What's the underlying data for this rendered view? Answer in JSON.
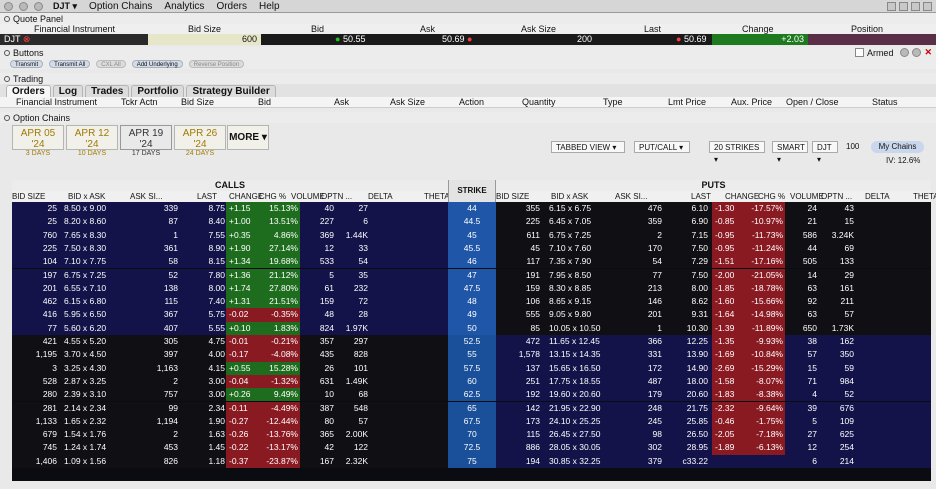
{
  "app": {
    "symbol": "DJT",
    "menus": [
      "Option Chains",
      "Analytics",
      "Orders",
      "Help"
    ]
  },
  "quote": {
    "section": "Quote Panel",
    "headers": [
      "Financial Instrument",
      "Bid Size",
      "Bid",
      "Ask",
      "Ask Size",
      "Last",
      "Change",
      "Position"
    ],
    "symbol": "DJT",
    "bid_size": "600",
    "bid": "50.55",
    "ask": "50.69",
    "ask_size": "200",
    "last": "50.69",
    "change": "+2.03",
    "position": ""
  },
  "buttons": {
    "section": "Buttons",
    "items": [
      "Transmit",
      "Transmit All",
      "CXL All",
      "Add Underlying",
      "Reverse Position"
    ],
    "armed": "Armed"
  },
  "trading": {
    "section": "Trading",
    "tabs": [
      "Orders",
      "Log",
      "Trades",
      "Portfolio",
      "Strategy Builder"
    ],
    "columns": [
      "Financial Instrument",
      "Tckr Actn",
      "Bid Size",
      "Bid",
      "Ask",
      "Ask Size",
      "Action",
      "Quantity",
      "Type",
      "Lmt Price",
      "Aux. Price",
      "Open / Close",
      "Status"
    ]
  },
  "chains": {
    "section": "Option Chains",
    "expiries": [
      {
        "label": "APR 05 '24",
        "days": "3 DAYS"
      },
      {
        "label": "APR 12 '24",
        "days": "10 DAYS"
      },
      {
        "label": "APR 19 '24",
        "days": "17 DAYS"
      },
      {
        "label": "APR 26 '24",
        "days": "24 DAYS"
      }
    ],
    "more": "MORE",
    "view": "TABBED VIEW",
    "type": "PUT/CALL",
    "strikes": "20 STRIKES",
    "exchange": "SMART",
    "under": "DJT",
    "mult": "100",
    "mychains": "My Chains",
    "iv": "IV: 12.6%",
    "calls_label": "CALLS",
    "puts_label": "PUTS",
    "strike_label": "STRIKE",
    "call_cols": [
      "BID SIZE",
      "BID x ASK",
      "ASK SI...",
      "LAST",
      "CHANGE",
      "CHG %",
      "VOLUME",
      "OPTN ...",
      "DELTA",
      "THETA"
    ],
    "put_cols": [
      "BID SIZE",
      "BID x ASK",
      "ASK SI...",
      "LAST",
      "CHANGE",
      "CHG %",
      "VOLUME",
      "OPTN ...",
      "DELTA",
      "THETA"
    ]
  },
  "rows": [
    {
      "strike": "44",
      "c": [
        "25",
        "8.50 x 9.00",
        "339",
        "8.75",
        "+1.15",
        "15.13%",
        "40",
        "27"
      ],
      "p": [
        "355",
        "6.15 x 6.75",
        "476",
        "6.10",
        "-1.30",
        "-17.57%",
        "24",
        "43"
      ]
    },
    {
      "strike": "44.5",
      "c": [
        "25",
        "8.20 x 8.60",
        "87",
        "8.40",
        "+1.00",
        "13.51%",
        "227",
        "6"
      ],
      "p": [
        "225",
        "6.45 x 7.05",
        "359",
        "6.90",
        "-0.85",
        "-10.97%",
        "21",
        "15"
      ]
    },
    {
      "strike": "45",
      "c": [
        "760",
        "7.65 x 8.30",
        "1",
        "7.55",
        "+0.35",
        "4.86%",
        "369",
        "1.44K"
      ],
      "p": [
        "611",
        "6.75 x 7.25",
        "2",
        "7.15",
        "-0.95",
        "-11.73%",
        "586",
        "3.24K"
      ]
    },
    {
      "strike": "45.5",
      "c": [
        "225",
        "7.50 x 8.30",
        "361",
        "8.90",
        "+1.90",
        "27.14%",
        "12",
        "33"
      ],
      "p": [
        "45",
        "7.10 x 7.60",
        "170",
        "7.50",
        "-0.95",
        "-11.24%",
        "44",
        "69"
      ]
    },
    {
      "strike": "46",
      "c": [
        "104",
        "7.10 x 7.75",
        "58",
        "8.15",
        "+1.34",
        "19.68%",
        "533",
        "54"
      ],
      "p": [
        "117",
        "7.35 x 7.90",
        "54",
        "7.29",
        "-1.51",
        "-17.16%",
        "505",
        "133"
      ]
    },
    {
      "strike": "47",
      "c": [
        "197",
        "6.75 x 7.25",
        "52",
        "7.80",
        "+1.36",
        "21.12%",
        "5",
        "35"
      ],
      "p": [
        "191",
        "7.95 x 8.50",
        "77",
        "7.50",
        "-2.00",
        "-21.05%",
        "14",
        "29"
      ]
    },
    {
      "strike": "47.5",
      "c": [
        "201",
        "6.55 x 7.10",
        "138",
        "8.00",
        "+1.74",
        "27.80%",
        "61",
        "232"
      ],
      "p": [
        "159",
        "8.30 x 8.85",
        "213",
        "8.00",
        "-1.85",
        "-18.78%",
        "63",
        "161"
      ]
    },
    {
      "strike": "48",
      "c": [
        "462",
        "6.15 x 6.80",
        "115",
        "7.40",
        "+1.31",
        "21.51%",
        "159",
        "72"
      ],
      "p": [
        "106",
        "8.65 x 9.15",
        "146",
        "8.62",
        "-1.60",
        "-15.66%",
        "92",
        "211"
      ]
    },
    {
      "strike": "49",
      "c": [
        "416",
        "5.95 x 6.50",
        "367",
        "5.75",
        "-0.02",
        "-0.35%",
        "48",
        "28"
      ],
      "p": [
        "555",
        "9.05 x 9.80",
        "201",
        "9.31",
        "-1.64",
        "-14.98%",
        "63",
        "57"
      ]
    },
    {
      "strike": "50",
      "c": [
        "77",
        "5.60 x 6.20",
        "407",
        "5.55",
        "+0.10",
        "1.83%",
        "824",
        "1.97K"
      ],
      "p": [
        "85",
        "10.05 x 10.50",
        "1",
        "10.30",
        "-1.39",
        "-11.89%",
        "650",
        "1.73K"
      ]
    },
    {
      "strike": "52.5",
      "c": [
        "421",
        "4.55 x 5.20",
        "305",
        "4.75",
        "-0.01",
        "-0.21%",
        "357",
        "297"
      ],
      "p": [
        "472",
        "11.65 x 12.45",
        "366",
        "12.25",
        "-1.35",
        "-9.93%",
        "38",
        "162"
      ]
    },
    {
      "strike": "55",
      "c": [
        "1,195",
        "3.70 x 4.50",
        "397",
        "4.00",
        "-0.17",
        "-4.08%",
        "435",
        "828"
      ],
      "p": [
        "1,578",
        "13.15 x 14.35",
        "331",
        "13.90",
        "-1.69",
        "-10.84%",
        "57",
        "350"
      ]
    },
    {
      "strike": "57.5",
      "c": [
        "3",
        "3.25 x 4.30",
        "1,163",
        "4.15",
        "+0.55",
        "15.28%",
        "26",
        "101"
      ],
      "p": [
        "137",
        "15.65 x 16.50",
        "172",
        "14.90",
        "-2.69",
        "-15.29%",
        "15",
        "59"
      ]
    },
    {
      "strike": "60",
      "c": [
        "528",
        "2.87 x 3.25",
        "2",
        "3.00",
        "-0.04",
        "-1.32%",
        "631",
        "1.49K"
      ],
      "p": [
        "251",
        "17.75 x 18.55",
        "487",
        "18.00",
        "-1.58",
        "-8.07%",
        "71",
        "984"
      ]
    },
    {
      "strike": "62.5",
      "c": [
        "280",
        "2.39 x 3.10",
        "757",
        "3.00",
        "+0.26",
        "9.49%",
        "10",
        "68"
      ],
      "p": [
        "192",
        "19.60 x 20.60",
        "179",
        "20.60",
        "-1.83",
        "-8.38%",
        "4",
        "52"
      ]
    },
    {
      "strike": "65",
      "c": [
        "281",
        "2.14 x 2.34",
        "99",
        "2.34",
        "-0.11",
        "-4.49%",
        "387",
        "548"
      ],
      "p": [
        "142",
        "21.95 x 22.90",
        "248",
        "21.75",
        "-2.32",
        "-9.64%",
        "39",
        "676"
      ]
    },
    {
      "strike": "67.5",
      "c": [
        "1,133",
        "1.65 x 2.32",
        "1,194",
        "1.90",
        "-0.27",
        "-12.44%",
        "80",
        "57"
      ],
      "p": [
        "173",
        "24.10 x 25.25",
        "245",
        "25.85",
        "-0.46",
        "-1.75%",
        "5",
        "109"
      ]
    },
    {
      "strike": "70",
      "c": [
        "679",
        "1.54 x 1.76",
        "2",
        "1.63",
        "-0.26",
        "-13.76%",
        "365",
        "2.00K"
      ],
      "p": [
        "115",
        "26.45 x 27.50",
        "98",
        "26.50",
        "-2.05",
        "-7.18%",
        "27",
        "625"
      ]
    },
    {
      "strike": "72.5",
      "c": [
        "745",
        "1.24 x 1.74",
        "453",
        "1.45",
        "-0.22",
        "-13.17%",
        "42",
        "122"
      ],
      "p": [
        "886",
        "28.05 x 30.05",
        "302",
        "28.95",
        "-1.89",
        "-6.13%",
        "12",
        "254"
      ]
    },
    {
      "strike": "75",
      "c": [
        "1,406",
        "1.09 x 1.56",
        "826",
        "1.18",
        "-0.37",
        "-23.87%",
        "167",
        "2.32K"
      ],
      "p": [
        "194",
        "30.85 x 32.25",
        "379",
        "c33.22",
        "",
        "",
        "6",
        "214"
      ]
    }
  ]
}
